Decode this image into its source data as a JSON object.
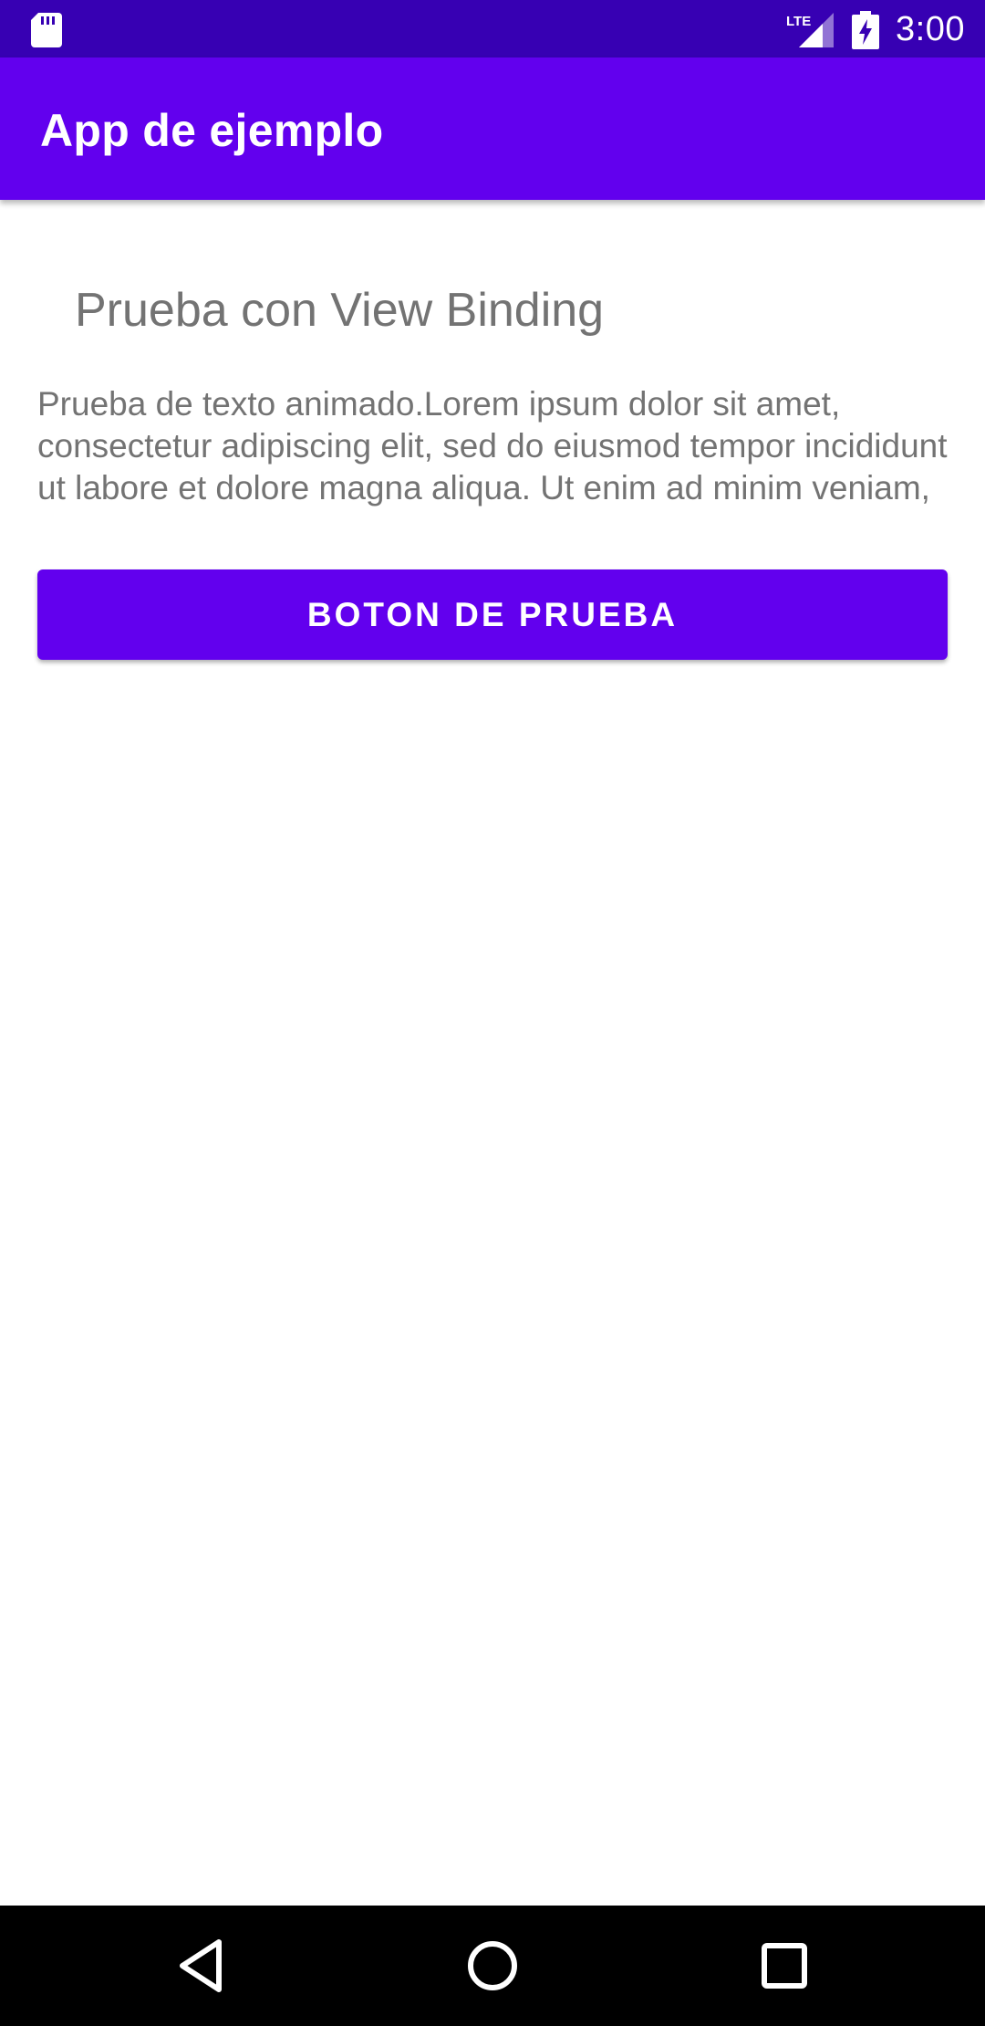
{
  "status_bar": {
    "time": "3:00",
    "network_label": "LTE",
    "icons": [
      "sd-card-icon",
      "lte-signal-icon",
      "battery-charging-icon"
    ],
    "background_color": "#3700B3"
  },
  "app_bar": {
    "title": "App de ejemplo",
    "background_color": "#6200EE"
  },
  "content": {
    "heading": "Prueba con View Binding",
    "body_text": "Prueba de texto animado.Lorem ipsum dolor sit amet, consectetur adipiscing elit, sed do eiusmod tempor incididunt ut labore et dolore magna aliqua. Ut enim ad minim veniam,",
    "button_label": "BOTON DE PRUEBA",
    "text_color": "#737373",
    "button_color": "#6200EE"
  },
  "nav_bar": {
    "buttons": [
      "back-icon",
      "home-icon",
      "recents-icon"
    ],
    "background_color": "#000000"
  }
}
